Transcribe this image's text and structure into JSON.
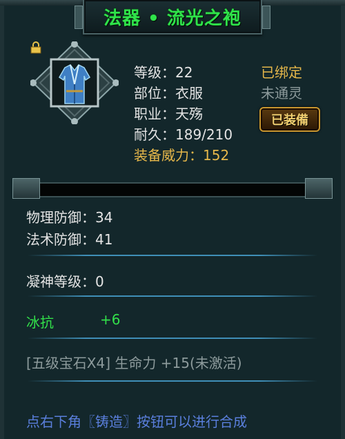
{
  "title": "法器 • 流光之袍",
  "item": {
    "icon": "blue-robe-icon",
    "locked": true,
    "stats": {
      "level": "等级：22",
      "slot": "部位：衣服",
      "job": "职业：天殇",
      "durability": "耐久：189/210",
      "power": "装备威力：152"
    },
    "status_bound": "已绑定",
    "status_spirit": "未通灵",
    "equipped_button": "已装備"
  },
  "defense": {
    "physical": "物理防御：34",
    "magic": "法术防御：41"
  },
  "focus_level": "凝神等级：0",
  "resist": {
    "label": "冰抗",
    "value": "+6"
  },
  "gem": "[五级宝石X4] 生命力 +15(未激活)",
  "hint": "点右下角〖铸造〗按钮可以进行合成",
  "colors": {
    "title": "#2fe34a",
    "stat_text": "#e4e4e4",
    "gold": "#e6b74a",
    "inactive": "#8d9b9c",
    "resist": "#32e04a",
    "hint": "#5a7fdc"
  }
}
